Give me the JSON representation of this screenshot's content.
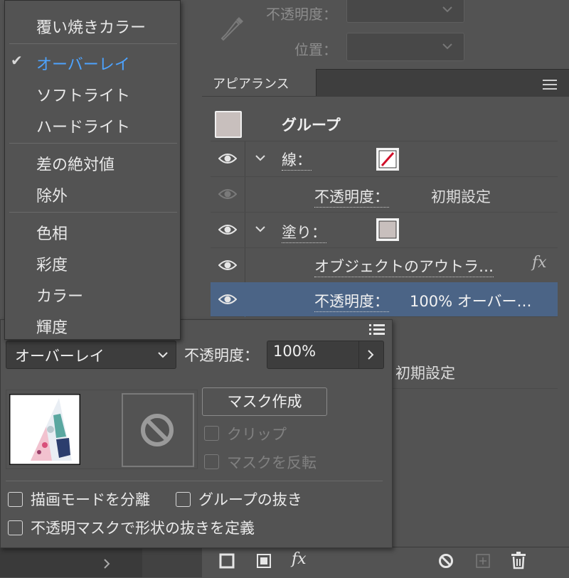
{
  "gradient_panel": {
    "opacity_label": "不透明度：",
    "position_label": "位置："
  },
  "appearance": {
    "tab_label": "アピアランス",
    "group_label": "グループ",
    "rows": [
      {
        "label": "線：",
        "value": ""
      },
      {
        "label": "不透明度：",
        "value": "初期設定"
      },
      {
        "label": "塗り：",
        "value": ""
      },
      {
        "label": "オブジェクトのアウトラ…",
        "value": ""
      },
      {
        "label": "不透明度：",
        "value": "100% オーバー…"
      },
      {
        "label": "",
        "value": "初期設定"
      }
    ],
    "fx_label": "fx"
  },
  "blend_menu": {
    "items": [
      {
        "label": "覆い焼きカラー",
        "checked": false
      },
      {
        "label": "オーバーレイ",
        "checked": true
      },
      {
        "label": "ソフトライト",
        "checked": false
      },
      {
        "label": "ハードライト",
        "checked": false
      },
      {
        "label": "差の絶対値",
        "checked": false
      },
      {
        "label": "除外",
        "checked": false
      },
      {
        "label": "色相",
        "checked": false
      },
      {
        "label": "彩度",
        "checked": false
      },
      {
        "label": "カラー",
        "checked": false
      },
      {
        "label": "輝度",
        "checked": false
      }
    ],
    "check_mark": "✔"
  },
  "transparency": {
    "blend_mode": "オーバーレイ",
    "opacity_label": "不透明度：",
    "opacity_value": "100%",
    "make_mask": "マスク作成",
    "clip": "クリップ",
    "invert_mask": "マスクを反転",
    "isolate_blending": "描画モードを分離",
    "knockout_group": "グループの抜き",
    "opacity_mask_knockout": "不透明マスクで形状の抜きを定義"
  },
  "colors": {
    "accent": "#4da3ff",
    "selected_row": "#4b6486",
    "panel_bg": "#535353"
  }
}
